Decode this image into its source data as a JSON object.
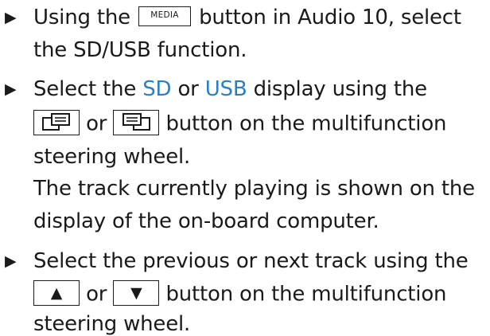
{
  "steps": [
    {
      "lines": [
        {
          "before": "Using the",
          "key": "MEDIA",
          "after": "button in Audio 10, select"
        },
        {
          "text": "the SD/USB function."
        }
      ]
    },
    {
      "lines": [
        {
          "before": "Select the",
          "hl1": "SD",
          "mid": "or",
          "hl2": "USB",
          "after": "display using the"
        },
        {
          "or": "or",
          "after": "button on the multifunction"
        },
        {
          "text": "steering wheel."
        }
      ],
      "result_lines": [
        "The track currently playing is shown on the",
        "display of the on-board computer."
      ]
    },
    {
      "lines": [
        {
          "text": "Select the previous or next track using the"
        },
        {
          "up_symbol": "▲",
          "or": "or",
          "down_symbol": "▼",
          "after": "button on the multifunction"
        },
        {
          "text": "steering wheel."
        }
      ]
    }
  ],
  "bullet_symbol": "▶",
  "colors": {
    "highlight": "#2a7fc4",
    "text": "#1a1a1a"
  }
}
